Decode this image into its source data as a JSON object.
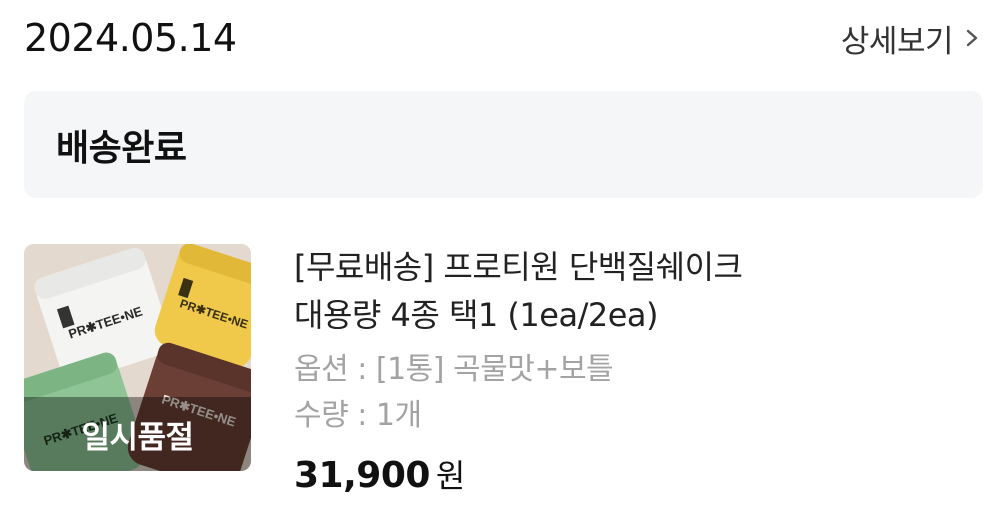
{
  "order": {
    "date": "2024.05.14",
    "detail_label": "상세보기",
    "status": "배송완료"
  },
  "product": {
    "name_line1": "[무료배송] 프로티원 단백질쉐이크",
    "name_line2": "대용량 4종 택1 (1ea/2ea)",
    "option_label": "옵션",
    "option_value": "[1통] 곡물맛+보틀",
    "quantity_label": "수량",
    "quantity_value": "1개",
    "price": "31,900",
    "price_unit": "원",
    "badge": "일시품절",
    "image_brand_text": "PR✱TEE•NE"
  },
  "icons": {
    "detail": "chevron-right-icon"
  }
}
